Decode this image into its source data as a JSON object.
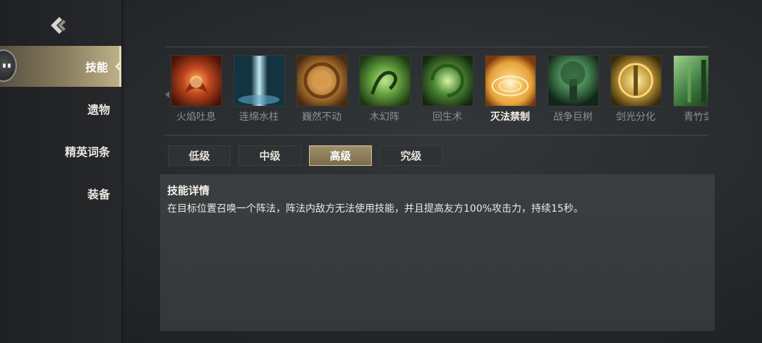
{
  "sidebar": {
    "items": [
      {
        "label": "技能",
        "active": true
      },
      {
        "label": "遗物",
        "active": false
      },
      {
        "label": "精英词条",
        "active": false
      },
      {
        "label": "装备",
        "active": false
      }
    ]
  },
  "icons": {
    "back": "chevron-left-icon",
    "avatar": "robot-avatar-icon",
    "active_indicator": "chevron-left-icon"
  },
  "skills": [
    {
      "name": "火焰吐息",
      "icon": "fire-breath-icon",
      "color": "#c0471e"
    },
    {
      "name": "连绵水柱",
      "icon": "water-pillar-icon",
      "color": "#5fa3c4"
    },
    {
      "name": "巍然不动",
      "icon": "earth-shield-icon",
      "color": "#b4762f"
    },
    {
      "name": "木幻阵",
      "icon": "wood-illusion-icon",
      "color": "#5e9a3b"
    },
    {
      "name": "回生术",
      "icon": "revive-icon",
      "color": "#4f8c35"
    },
    {
      "name": "灭法禁制",
      "icon": "magic-seal-icon",
      "color": "#e7a23a",
      "selected": true
    },
    {
      "name": "战争巨树",
      "icon": "war-tree-icon",
      "color": "#3f7a4c"
    },
    {
      "name": "剑光分化",
      "icon": "sword-light-icon",
      "color": "#c39a34"
    },
    {
      "name": "青竹剑",
      "icon": "bamboo-sword-icon",
      "color": "#3b7a3e"
    }
  ],
  "tiers": [
    {
      "label": "低级",
      "active": false
    },
    {
      "label": "中级",
      "active": false
    },
    {
      "label": "高级",
      "active": true
    },
    {
      "label": "究级",
      "active": false
    }
  ],
  "details": {
    "title": "技能详情",
    "text": "在目标位置召唤一个阵法，阵法内敌方无法使用技能，并且提高友方100%攻击力，持续15秒。"
  },
  "colors": {
    "accent_gold": "#bdb08a",
    "panel": "#3b3e41",
    "background": "#26292c"
  }
}
